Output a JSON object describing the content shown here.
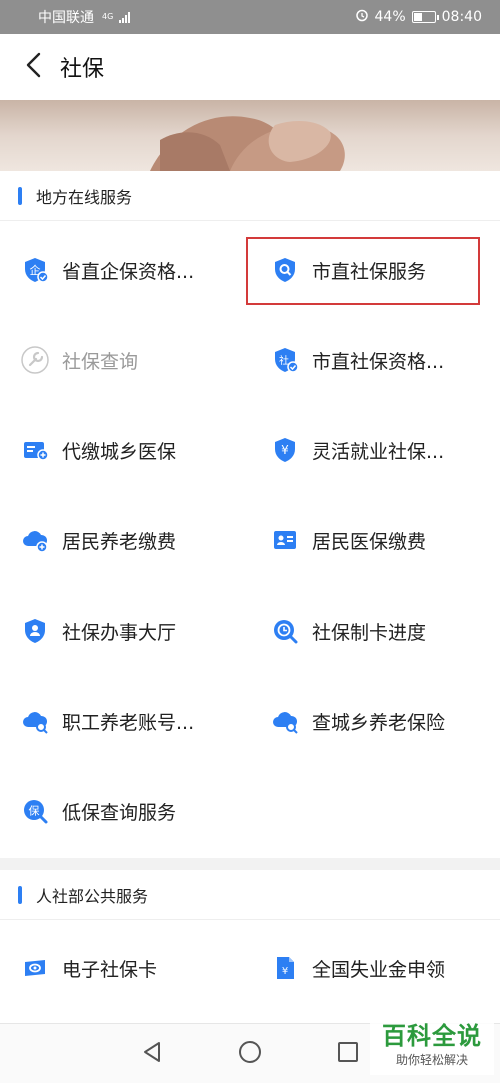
{
  "status_bar": {
    "carrier": "中国联通",
    "network": "4G",
    "battery": "44%",
    "battery_level": 0.44,
    "time": "08:40"
  },
  "header": {
    "title": "社保",
    "back_icon": "chevron-left-icon"
  },
  "sections": [
    {
      "title": "地方在线服务",
      "items": [
        {
          "label": "省直企保资格...",
          "icon": "shield-person-icon",
          "enabled": true
        },
        {
          "label": "市直社保服务",
          "icon": "shield-search-icon",
          "enabled": true,
          "highlighted": true
        },
        {
          "label": "社保查询",
          "icon": "wrench-icon",
          "enabled": false
        },
        {
          "label": "市直社保资格...",
          "icon": "shield-check-icon",
          "enabled": true
        },
        {
          "label": "代缴城乡医保",
          "icon": "card-plus-icon",
          "enabled": true
        },
        {
          "label": "灵活就业社保...",
          "icon": "shield-yen-icon",
          "enabled": true
        },
        {
          "label": "居民养老缴费",
          "icon": "cloud-plus-icon",
          "enabled": true
        },
        {
          "label": "居民医保缴费",
          "icon": "id-card-icon",
          "enabled": true
        },
        {
          "label": "社保办事大厅",
          "icon": "shield-user-icon",
          "enabled": true
        },
        {
          "label": "社保制卡进度",
          "icon": "clock-search-icon",
          "enabled": true
        },
        {
          "label": "职工养老账号...",
          "icon": "cloud-search-icon",
          "enabled": true
        },
        {
          "label": "查城乡养老保险",
          "icon": "cloud-search-icon",
          "enabled": true
        },
        {
          "label": "低保查询服务",
          "icon": "bao-search-icon",
          "enabled": true
        }
      ]
    },
    {
      "title": "人社部公共服务",
      "items": [
        {
          "label": "电子社保卡",
          "icon": "card-icon",
          "enabled": true
        },
        {
          "label": "全国失业金申领",
          "icon": "document-yen-icon",
          "enabled": true
        }
      ]
    }
  ],
  "nav_bar": {
    "back": "triangle-back-icon",
    "home": "circle-home-icon",
    "recent": "square-recent-icon"
  },
  "watermark": {
    "title": "百科全说",
    "subtitle": "助你轻松解决"
  },
  "colors": {
    "accent": "#2d7ff3",
    "highlight": "#d33a3a",
    "disabled": "#9a9a9a",
    "watermark": "#2c9a3d"
  }
}
